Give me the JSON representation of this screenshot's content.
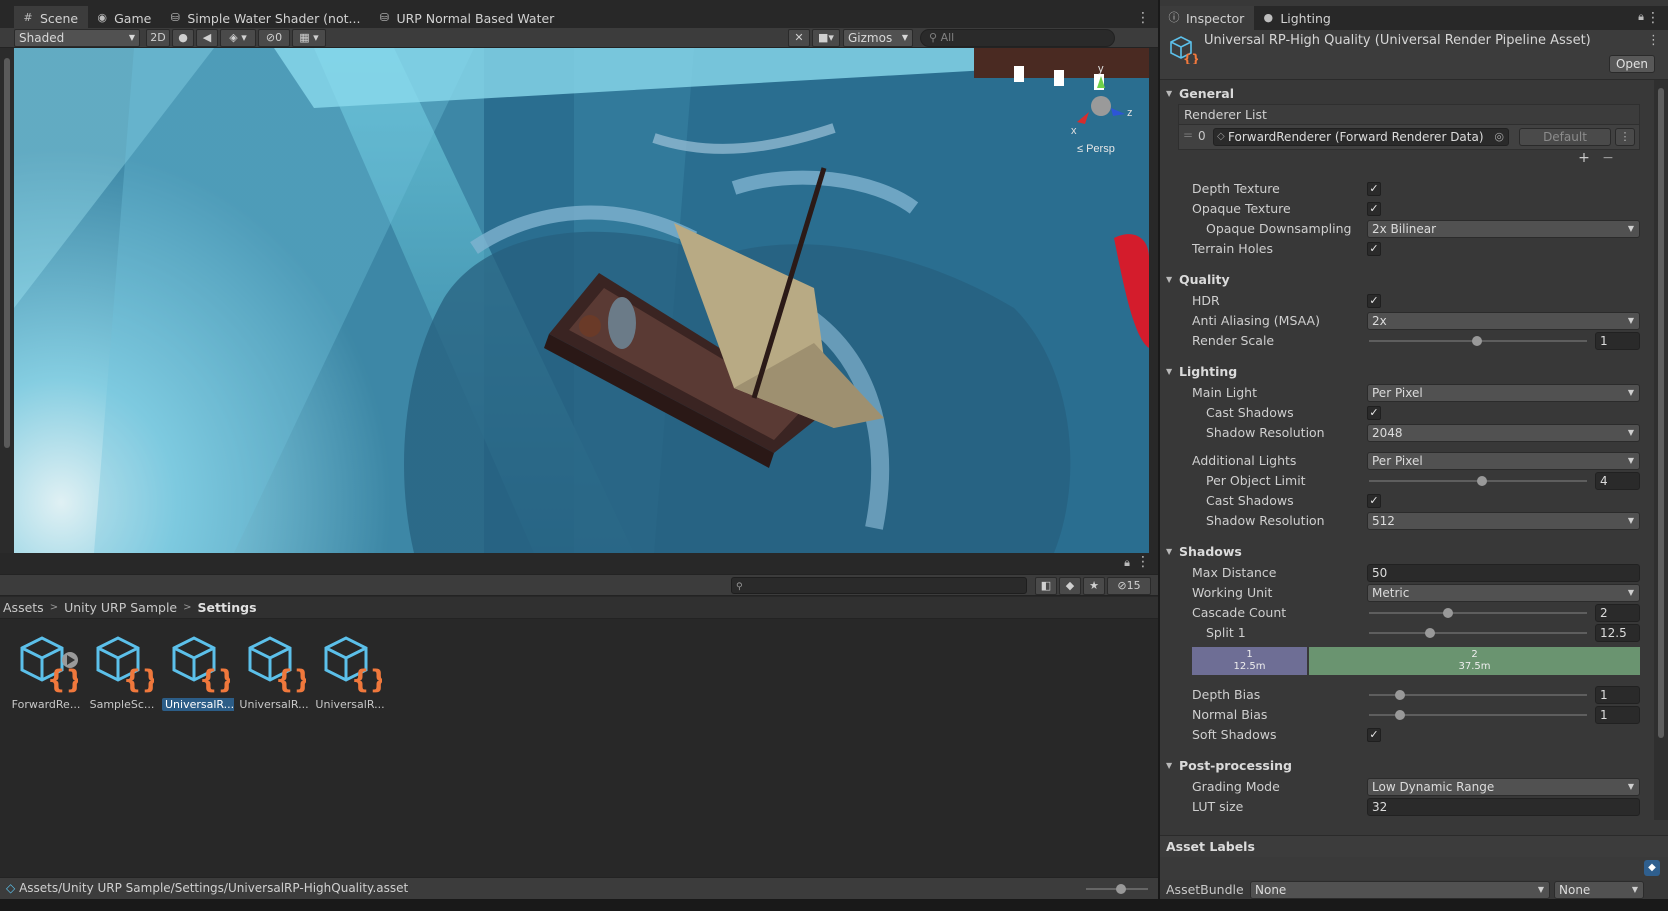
{
  "scene_tabs": [
    {
      "label": "Scene",
      "icon": "hash-icon"
    },
    {
      "label": "Game",
      "icon": "gamepad-icon"
    },
    {
      "label": "Simple Water Shader (not...",
      "icon": "shader-icon"
    },
    {
      "label": "URP Normal Based Water",
      "icon": "shader-icon"
    }
  ],
  "scene_toolbar": {
    "draw_mode": "Shaded",
    "toggle_2d": "2D",
    "hidden_count": "0",
    "gizmos": "Gizmos",
    "search_placeholder": "All"
  },
  "gizmo": {
    "y": "y",
    "x": "x",
    "z": "z",
    "persp": "≤ Persp"
  },
  "project": {
    "hidden_count": "15",
    "breadcrumb": [
      "Assets",
      "Unity URP Sample",
      "Settings"
    ],
    "assets": [
      {
        "label": "ForwardRe...",
        "icon": "renderer-asset-icon",
        "selected": false
      },
      {
        "label": "SampleSc...",
        "icon": "asset-icon",
        "selected": false
      },
      {
        "label": "UniversalR...",
        "icon": "asset-icon",
        "selected": true
      },
      {
        "label": "UniversalR...",
        "icon": "asset-icon",
        "selected": false
      },
      {
        "label": "UniversalR...",
        "icon": "asset-icon",
        "selected": false
      }
    ],
    "status_path": "Assets/Unity URP Sample/Settings/UniversalRP-HighQuality.asset"
  },
  "inspector_tabs": [
    {
      "label": "Inspector",
      "icon": "info-icon"
    },
    {
      "label": "Lighting",
      "icon": "light-icon"
    }
  ],
  "inspector": {
    "title": "Universal RP-High Quality (Universal Render Pipeline Asset)",
    "open_label": "Open",
    "general": {
      "header": "General",
      "renderer_list": "Renderer List",
      "renderer_index": "0",
      "renderer_name": "ForwardRenderer (Forward Renderer Data)",
      "default_label": "Default",
      "depth_texture": "Depth Texture",
      "opaque_texture": "Opaque Texture",
      "opaque_downsampling": "Opaque Downsampling",
      "opaque_downsampling_value": "2x Bilinear",
      "terrain_holes": "Terrain Holes"
    },
    "quality": {
      "header": "Quality",
      "hdr": "HDR",
      "msaa": "Anti Aliasing (MSAA)",
      "msaa_value": "2x",
      "render_scale": "Render Scale",
      "render_scale_value": "1"
    },
    "lighting": {
      "header": "Lighting",
      "main_light": "Main Light",
      "main_light_value": "Per Pixel",
      "cast_shadows": "Cast Shadows",
      "shadow_resolution": "Shadow Resolution",
      "shadow_resolution_value": "2048",
      "additional_lights": "Additional Lights",
      "additional_lights_value": "Per Pixel",
      "per_object_limit": "Per Object Limit",
      "per_object_limit_value": "4",
      "add_cast_shadows": "Cast Shadows",
      "add_shadow_resolution": "Shadow Resolution",
      "add_shadow_resolution_value": "512"
    },
    "shadows": {
      "header": "Shadows",
      "max_distance": "Max Distance",
      "max_distance_value": "50",
      "working_unit": "Working Unit",
      "working_unit_value": "Metric",
      "cascade_count": "Cascade Count",
      "cascade_count_value": "2",
      "split1": "Split 1",
      "split1_value": "12.5",
      "cascade1_index": "1",
      "cascade1_dist": "12.5m",
      "cascade2_index": "2",
      "cascade2_dist": "37.5m",
      "depth_bias": "Depth Bias",
      "depth_bias_value": "1",
      "normal_bias": "Normal Bias",
      "normal_bias_value": "1",
      "soft_shadows": "Soft Shadows"
    },
    "post": {
      "header": "Post-processing",
      "grading_mode": "Grading Mode",
      "grading_mode_value": "Low Dynamic Range",
      "lut_size": "LUT size",
      "lut_size_value": "32"
    },
    "asset_labels": "Asset Labels",
    "asset_bundle": "AssetBundle",
    "asset_bundle_value": "None",
    "asset_bundle_variant": "None"
  }
}
